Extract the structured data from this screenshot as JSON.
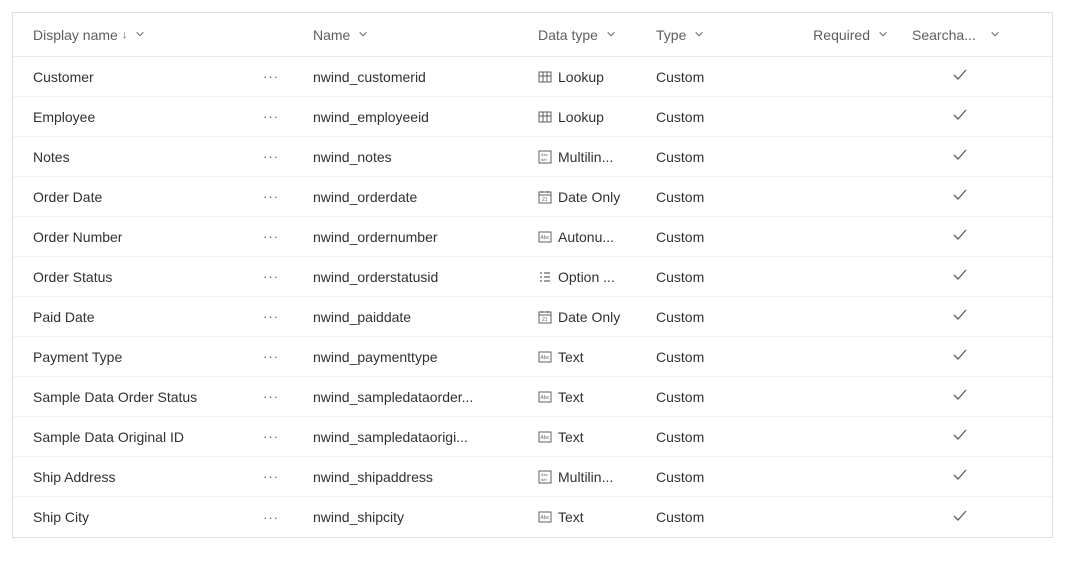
{
  "columns": {
    "display_name": "Display name",
    "name": "Name",
    "data_type": "Data type",
    "type": "Type",
    "required": "Required",
    "searchable": "Searcha..."
  },
  "rows": [
    {
      "display": "Customer",
      "name": "nwind_customerid",
      "datatype": "Lookup",
      "datatype_icon": "lookup",
      "type": "Custom",
      "required": "",
      "searchable": true
    },
    {
      "display": "Employee",
      "name": "nwind_employeeid",
      "datatype": "Lookup",
      "datatype_icon": "lookup",
      "type": "Custom",
      "required": "",
      "searchable": true
    },
    {
      "display": "Notes",
      "name": "nwind_notes",
      "datatype": "Multilin...",
      "datatype_icon": "multiline",
      "type": "Custom",
      "required": "",
      "searchable": true
    },
    {
      "display": "Order Date",
      "name": "nwind_orderdate",
      "datatype": "Date Only",
      "datatype_icon": "date",
      "type": "Custom",
      "required": "",
      "searchable": true
    },
    {
      "display": "Order Number",
      "name": "nwind_ordernumber",
      "datatype": "Autonu...",
      "datatype_icon": "autonumber",
      "type": "Custom",
      "required": "",
      "searchable": true
    },
    {
      "display": "Order Status",
      "name": "nwind_orderstatusid",
      "datatype": "Option ...",
      "datatype_icon": "optionset",
      "type": "Custom",
      "required": "",
      "searchable": true
    },
    {
      "display": "Paid Date",
      "name": "nwind_paiddate",
      "datatype": "Date Only",
      "datatype_icon": "date",
      "type": "Custom",
      "required": "",
      "searchable": true
    },
    {
      "display": "Payment Type",
      "name": "nwind_paymenttype",
      "datatype": "Text",
      "datatype_icon": "text",
      "type": "Custom",
      "required": "",
      "searchable": true
    },
    {
      "display": "Sample Data Order Status",
      "name": "nwind_sampledataorder...",
      "datatype": "Text",
      "datatype_icon": "text",
      "type": "Custom",
      "required": "",
      "searchable": true
    },
    {
      "display": "Sample Data Original ID",
      "name": "nwind_sampledataorigi...",
      "datatype": "Text",
      "datatype_icon": "text",
      "type": "Custom",
      "required": "",
      "searchable": true
    },
    {
      "display": "Ship Address",
      "name": "nwind_shipaddress",
      "datatype": "Multilin...",
      "datatype_icon": "multiline",
      "type": "Custom",
      "required": "",
      "searchable": true
    },
    {
      "display": "Ship City",
      "name": "nwind_shipcity",
      "datatype": "Text",
      "datatype_icon": "text",
      "type": "Custom",
      "required": "",
      "searchable": true
    }
  ]
}
